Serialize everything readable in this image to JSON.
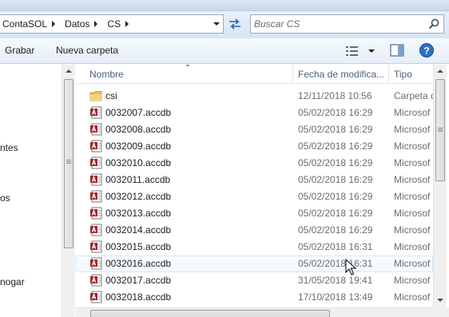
{
  "address": {
    "crumbs": [
      "ContaSOL",
      "Datos",
      "CS"
    ]
  },
  "search": {
    "placeholder": "Buscar CS"
  },
  "toolbar": {
    "grabar_label": "Grabar",
    "nueva_carpeta_label": "Nueva carpeta"
  },
  "nav": {
    "items": [
      "ntes",
      "os",
      "nogar"
    ]
  },
  "columns": {
    "name": "Nombre",
    "date": "Fecha de modifica...",
    "type": "Tipo"
  },
  "files": [
    {
      "name": "csi",
      "date": "12/11/2018 10:56",
      "type": "Carpeta d",
      "kind": "folder-icon"
    },
    {
      "name": "0032007.accdb",
      "date": "05/02/2018 16:29",
      "type": "Microsof",
      "kind": "access-file-icon"
    },
    {
      "name": "0032008.accdb",
      "date": "05/02/2018 16:29",
      "type": "Microsof",
      "kind": "access-file-icon"
    },
    {
      "name": "0032009.accdb",
      "date": "05/02/2018 16:29",
      "type": "Microsof",
      "kind": "access-file-icon"
    },
    {
      "name": "0032010.accdb",
      "date": "05/02/2018 16:29",
      "type": "Microsof",
      "kind": "access-file-icon"
    },
    {
      "name": "0032011.accdb",
      "date": "05/02/2018 16:29",
      "type": "Microsof",
      "kind": "access-file-icon"
    },
    {
      "name": "0032012.accdb",
      "date": "05/02/2018 16:29",
      "type": "Microsof",
      "kind": "access-file-icon"
    },
    {
      "name": "0032013.accdb",
      "date": "05/02/2018 16:29",
      "type": "Microsof",
      "kind": "access-file-icon"
    },
    {
      "name": "0032014.accdb",
      "date": "05/02/2018 16:29",
      "type": "Microsof",
      "kind": "access-file-icon"
    },
    {
      "name": "0032015.accdb",
      "date": "05/02/2018 16:31",
      "type": "Microsof",
      "kind": "access-file-icon"
    },
    {
      "name": "0032016.accdb",
      "date": "05/02/2018 16:31",
      "type": "Microsof",
      "kind": "access-file-icon"
    },
    {
      "name": "0032017.accdb",
      "date": "31/05/2018 19:41",
      "type": "Microsof",
      "kind": "access-file-icon"
    },
    {
      "name": "0032018.accdb",
      "date": "17/10/2018 13:49",
      "type": "Microsof",
      "kind": "access-file-icon"
    }
  ],
  "hovered_row": "0032016.accdb",
  "colors": {
    "header_text": "#4c607a",
    "meta_text": "#6d6d6d",
    "hover_border": "#d6e7f7",
    "folder": "#e8c25a",
    "access_red": "#a4262c"
  }
}
